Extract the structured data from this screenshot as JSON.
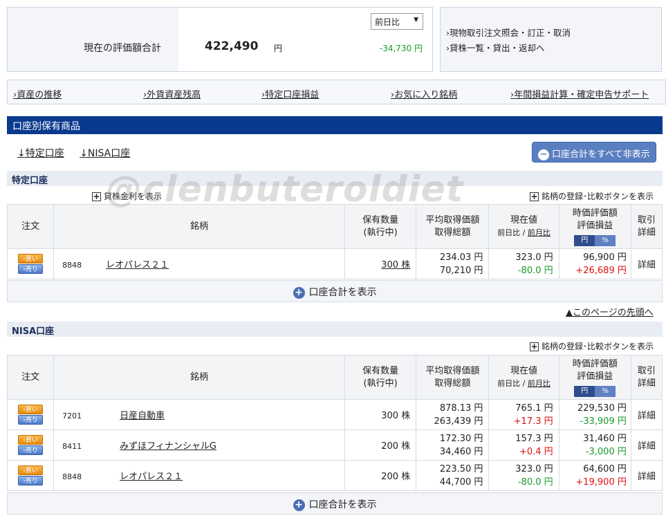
{
  "summary": {
    "label": "現在の評価額合計",
    "value": "422,490",
    "yen": "円",
    "compare_select": "前日比",
    "change": "-34,730 円"
  },
  "quicklinks": [
    "›現物取引注文照会・訂正・取消",
    "›貸株一覧・貸出・返却へ"
  ],
  "nav": [
    "›資産の推移",
    "›外貨資産残高",
    "›特定口座損益",
    "›お気に入り銘柄",
    "›年間損益計算・確定申告サポート"
  ],
  "section_title": "口座別保有商品",
  "account_links": [
    "↓特定口座",
    "↓NISA口座"
  ],
  "hide_all_button": "口座合計をすべて非表示",
  "watermark": "@clenbuteroldiet",
  "table_headers": {
    "order": "注文",
    "name": "銘柄",
    "qty_line1": "保有数量",
    "qty_line2": "(執行中)",
    "avg_line1": "平均取得価額",
    "avg_line2": "取得総額",
    "cur_line1": "現在値",
    "cur_line2a": "前日比",
    "cur_sep": " / ",
    "cur_line2b": "前月比",
    "val_line1": "時価評価額",
    "val_line2": "評価損益",
    "seg_yen": "円",
    "seg_pct": "%",
    "det_line1": "取引",
    "det_line2": "詳細"
  },
  "buy_label": "›買い",
  "sell_label": "›売り",
  "show_total": "口座合計を表示",
  "page_top": "▲このページの先頭へ",
  "tokutei": {
    "title": "特定口座",
    "lending_link": "貸株金利を表示",
    "register_link": "銘柄の登録･比較ボタンを表示",
    "rows": [
      {
        "code": "8848",
        "name": "レオパレス２１",
        "qty": "300 株",
        "avg": "234.03 円",
        "total": "70,210 円",
        "price": "323.0 円",
        "diff": "-80.0 円",
        "value": "96,900 円",
        "pl": "+26,689 円",
        "detail": "詳細"
      }
    ]
  },
  "nisa": {
    "title": "NISA口座",
    "register_link": "銘柄の登録･比較ボタンを表示",
    "rows": [
      {
        "code": "7201",
        "name": "日産自動車",
        "qty": "300 株",
        "avg": "878.13 円",
        "total": "263,439 円",
        "price": "765.1 円",
        "diff": "+17.3 円",
        "value": "229,530 円",
        "pl": "-33,909 円",
        "detail": "詳細"
      },
      {
        "code": "8411",
        "name": "みずほフィナンシャルG",
        "qty": "200 株",
        "avg": "172.30 円",
        "total": "34,460 円",
        "price": "157.3 円",
        "diff": "+0.4 円",
        "value": "31,460 円",
        "pl": "-3,000 円",
        "detail": "詳細"
      },
      {
        "code": "8848",
        "name": "レオパレス２１",
        "qty": "200 株",
        "avg": "223.50 円",
        "total": "44,700 円",
        "price": "323.0 円",
        "diff": "-80.0 円",
        "value": "64,600 円",
        "pl": "+19,900 円",
        "detail": "詳細"
      }
    ]
  },
  "colors": {
    "header_navy": "#0a3a8e",
    "gain_red": "#e01010",
    "loss_green": "#1a9a2a",
    "button_blue": "#5a7fc0"
  }
}
